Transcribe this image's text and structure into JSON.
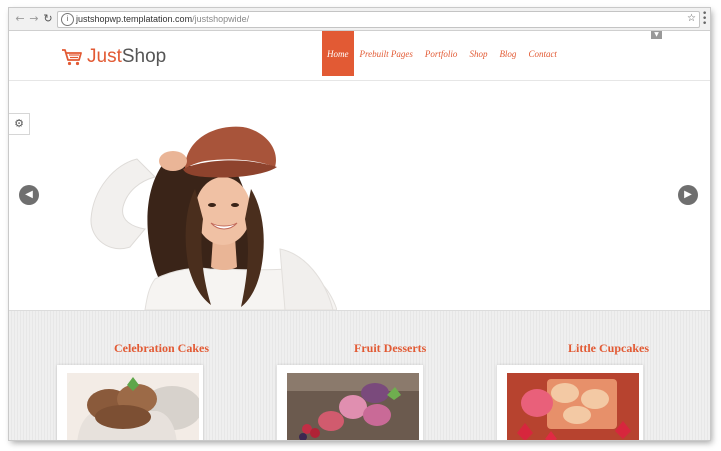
{
  "browser": {
    "back_icon": "arrow-left-icon",
    "forward_icon": "arrow-right-icon",
    "reload_icon": "reload-icon",
    "url_host": "justshopwp.templatation.com",
    "url_path": "/justshopwide/"
  },
  "site": {
    "logo_part1": "Just",
    "logo_part2": "Shop",
    "accent_color": "#e25a34",
    "nav": [
      {
        "label": "Home",
        "active": true
      },
      {
        "label": "Prebuilt Pages",
        "active": false
      },
      {
        "label": "Portfolio",
        "active": false
      },
      {
        "label": "Shop",
        "active": false
      },
      {
        "label": "Blog",
        "active": false
      },
      {
        "label": "Contact",
        "active": false
      }
    ]
  },
  "categories": [
    {
      "title": "Celebration Cakes"
    },
    {
      "title": "Fruit Desserts"
    },
    {
      "title": "Little Cupcakes"
    }
  ]
}
